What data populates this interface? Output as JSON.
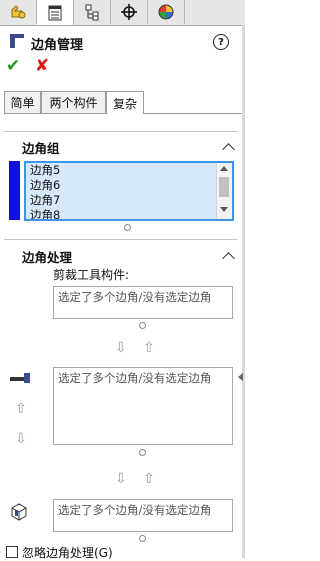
{
  "icon_tabs": [
    {
      "icon": "feature-manager-icon",
      "active": false
    },
    {
      "icon": "property-manager-icon",
      "active": true
    },
    {
      "icon": "configuration-manager-icon",
      "active": false
    },
    {
      "icon": "dimxpert-icon",
      "active": false
    },
    {
      "icon": "display-manager-icon",
      "active": false
    }
  ],
  "panel": {
    "title": "边角管理",
    "help": "?",
    "ok": "✔",
    "cancel": "✘"
  },
  "tabs": [
    {
      "label": "简单",
      "active": false
    },
    {
      "label": "两个构件",
      "active": false
    },
    {
      "label": "复杂",
      "active": true
    }
  ],
  "corner_group": {
    "title": "边角组",
    "items": [
      "边角5",
      "边角6",
      "边角7",
      "边角8"
    ]
  },
  "corner_treatment": {
    "title": "边角处理",
    "trim_label": "剪裁工具构件:",
    "placeholder": "选定了多个边角/没有选定边角",
    "field1": "选定了多个边角/没有选定边角",
    "field2": "选定了多个边角/没有选定边角",
    "field3": "选定了多个边角/没有选定边角"
  },
  "ignore_checkbox": {
    "label": "忽略边角处理(G)",
    "checked": false
  },
  "colors": {
    "accent_blue": "#1010e0",
    "selection_border": "#3f96e6",
    "selection_fill": "#d6e8fa",
    "ok_green": "#1f9a1f",
    "cancel_red": "#d81a1a"
  }
}
